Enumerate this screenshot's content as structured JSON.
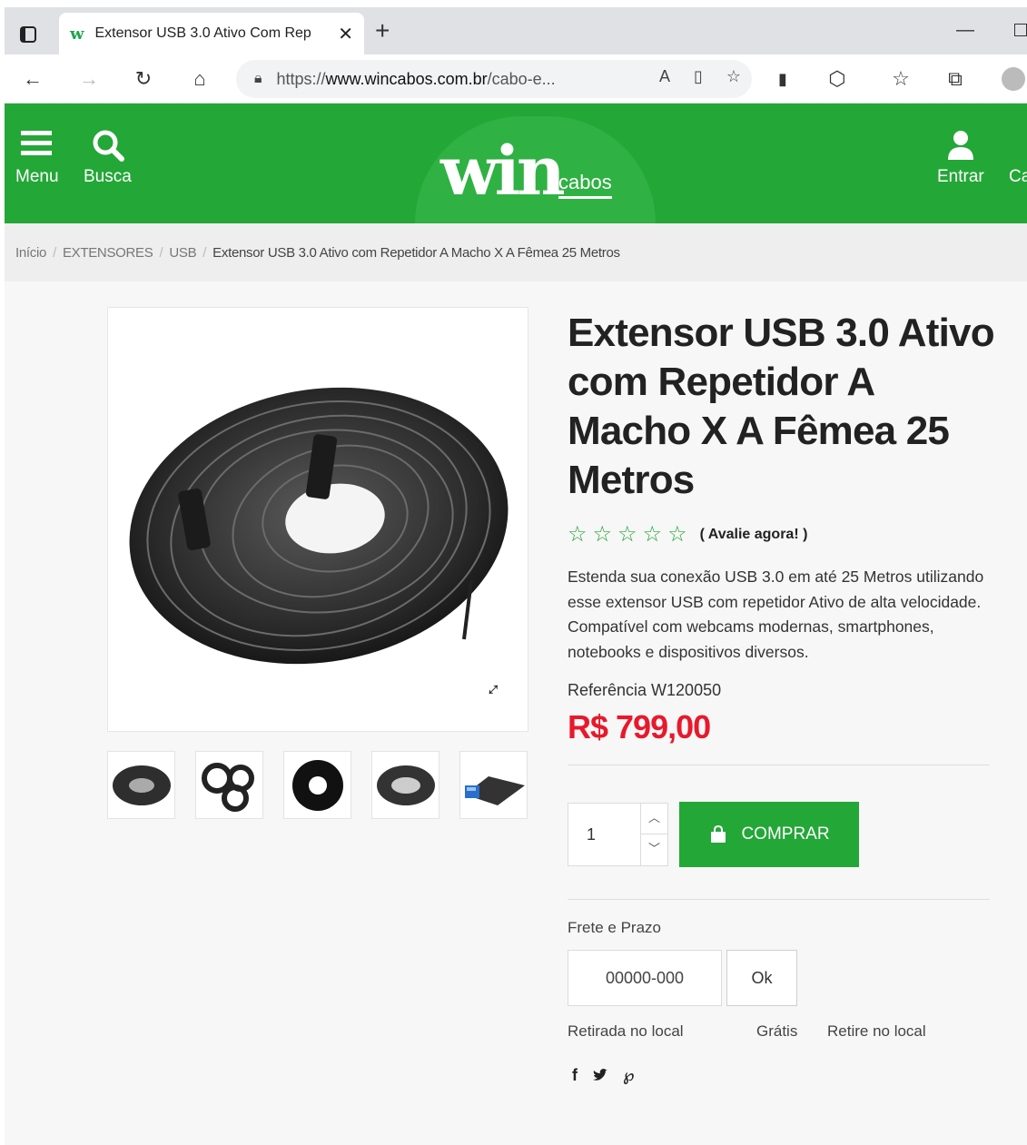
{
  "browser": {
    "tab_title": "Extensor USB 3.0 Ativo Com Rep",
    "favicon": "w",
    "url_prefix": "https://",
    "url_domain": "www.wincabos.com.br",
    "url_path": "/cabo-e..."
  },
  "header": {
    "menu_label": "Menu",
    "search_label": "Busca",
    "login_label": "Entrar",
    "cart_label_partial": "Ca",
    "logo_main": "win",
    "logo_sub": "cabos",
    "brand_color": "#23a737"
  },
  "breadcrumb": {
    "items": [
      "Início",
      "EXTENSORES",
      "USB"
    ],
    "current": "Extensor USB 3.0 Ativo com Repetidor A Macho X A Fêmea 25 Metros"
  },
  "product": {
    "title": "Extensor USB 3.0 Ativo com Repetidor A Macho X A Fêmea 25 Metros",
    "rating_stars": 0,
    "rating_max": 5,
    "rate_link": "( Avalie agora! )",
    "description": "Estenda sua conexão USB 3.0 em até 25 Metros utilizando esse extensor USB com repetidor Ativo de alta velocidade. Compatível com webcams modernas, smartphones, notebooks e dispositivos diversos.",
    "reference": "Referência W120050",
    "price": "R$ 799,00",
    "price_color": "#e8192c",
    "quantity": "1",
    "buy_label": "COMPRAR",
    "thumbnail_count": 5
  },
  "shipping": {
    "label": "Frete e Prazo",
    "cep_placeholder": "00000-000",
    "ok_label": "Ok",
    "option_name": "Retirada no local",
    "option_price": "Grátis",
    "option_desc": "Retire no local"
  }
}
